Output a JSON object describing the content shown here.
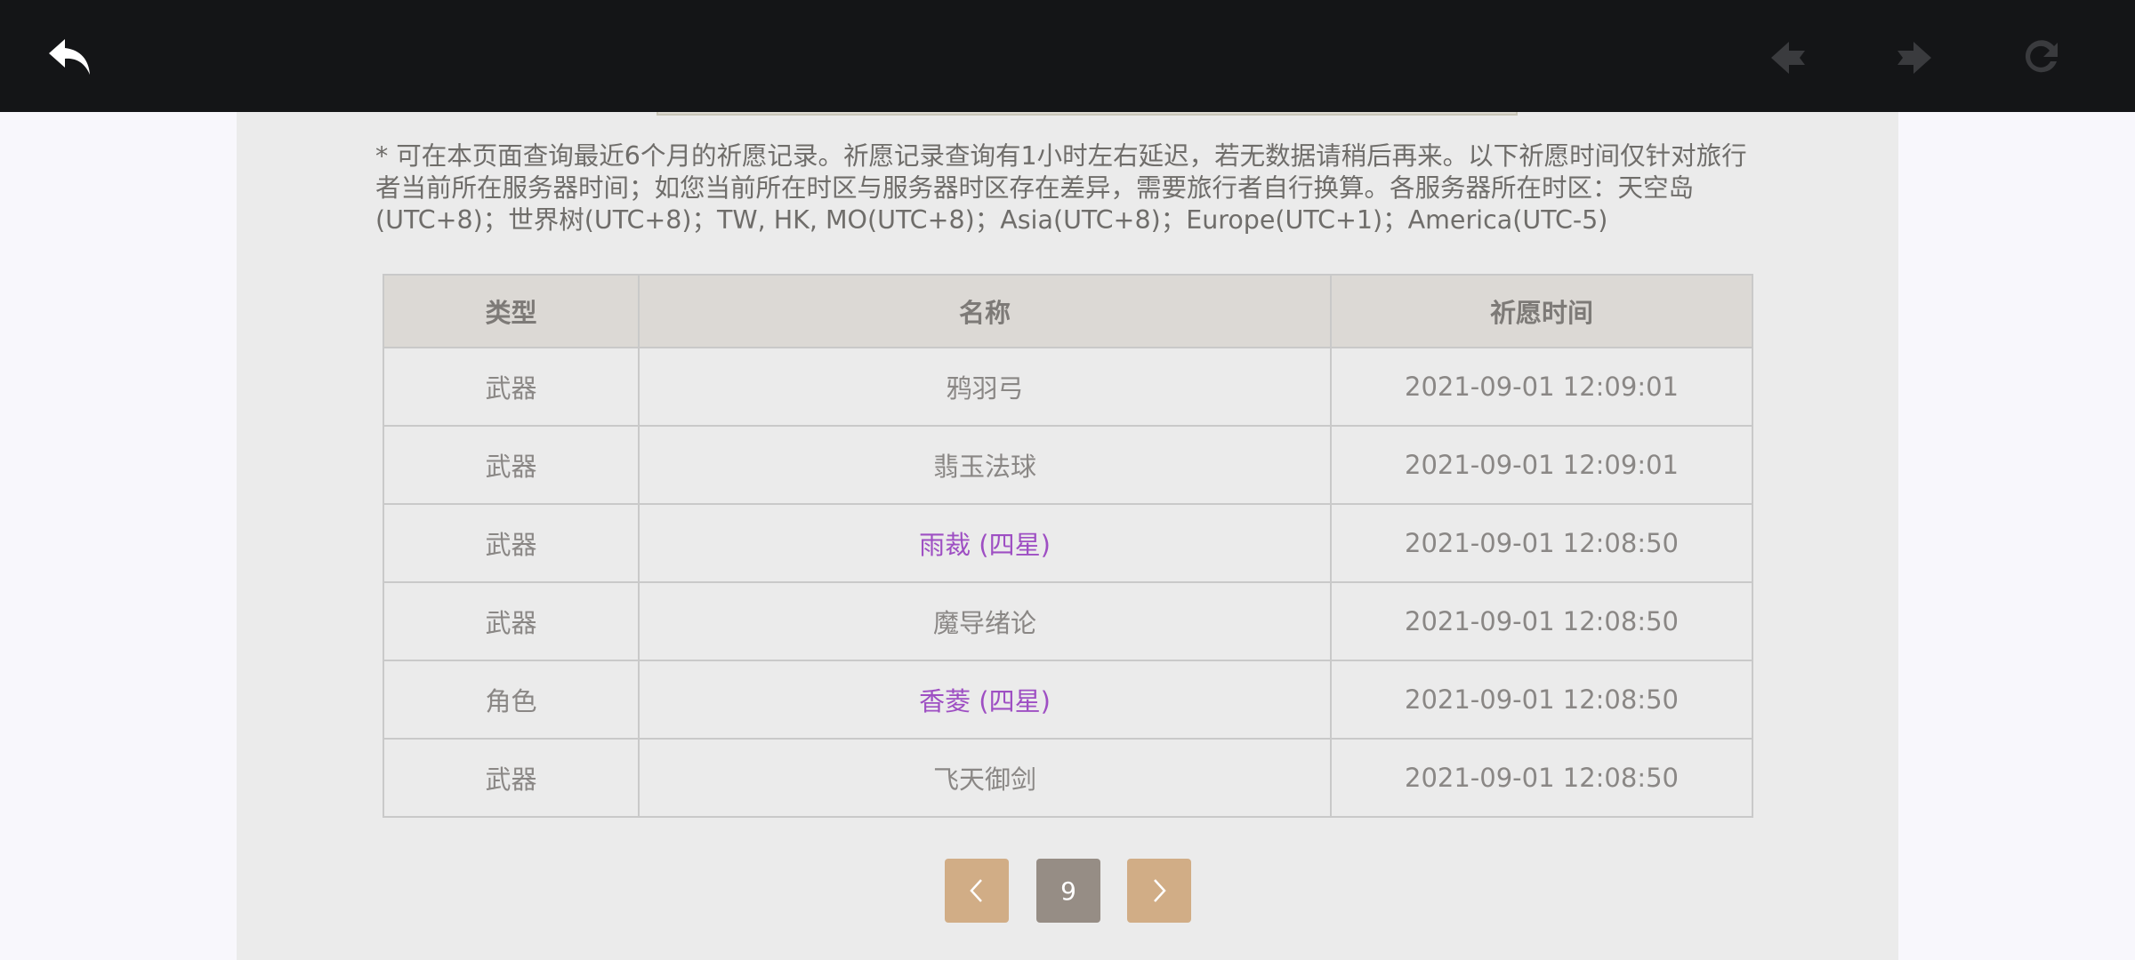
{
  "notice": "* 可在本页面查询最近6个月的祈愿记录。祈愿记录查询有1小时左右延迟，若无数据请稍后再来。以下祈愿时间仅针对旅行者当前所在服务器时间；如您当前所在时区与服务器时区存在差异，需要旅行者自行换算。各服务器所在时区：天空岛(UTC+8)；世界树(UTC+8)；TW, HK, MO(UTC+8)；Asia(UTC+8)；Europe(UTC+1)；America(UTC-5)",
  "table": {
    "headers": [
      "类型",
      "名称",
      "祈愿时间"
    ],
    "rows": [
      {
        "type": "武器",
        "name": "鸦羽弓",
        "time": "2021-09-01 12:09:01"
      },
      {
        "type": "武器",
        "name": "翡玉法球",
        "time": "2021-09-01 12:09:01"
      },
      {
        "type": "武器",
        "name": "雨裁 (四星)",
        "time": "2021-09-01 12:08:50"
      },
      {
        "type": "武器",
        "name": "魔导绪论",
        "time": "2021-09-01 12:08:50"
      },
      {
        "type": "角色",
        "name": "香菱 (四星)",
        "time": "2021-09-01 12:08:50"
      },
      {
        "type": "武器",
        "name": "飞天御剑",
        "time": "2021-09-01 12:08:50"
      }
    ]
  },
  "pagination": {
    "current_page": "9"
  },
  "colors": {
    "topbar": "#141517",
    "four_star": "#9e4fc3",
    "pager_button": "#d1ad86",
    "pager_current": "#968d85"
  },
  "icons": {
    "back": "back-arrow-icon",
    "prev": "prev-page-icon",
    "next": "next-page-icon",
    "refresh": "refresh-icon"
  }
}
